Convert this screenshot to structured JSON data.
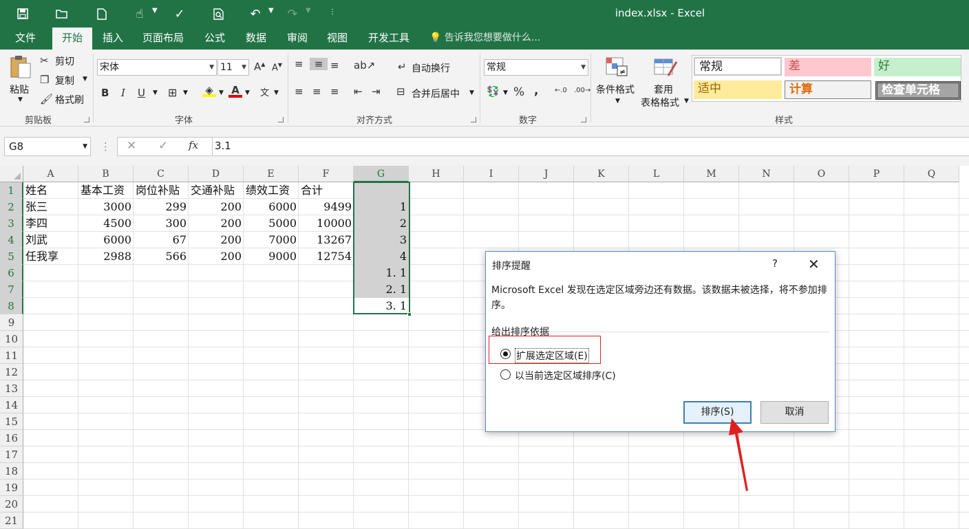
{
  "app": {
    "window_title": "index.xlsx - Excel"
  },
  "tabs": [
    "文件",
    "开始",
    "插入",
    "页面布局",
    "公式",
    "数据",
    "审阅",
    "视图",
    "开发工具"
  ],
  "tell_me": "告诉我您想要做什么...",
  "ribbon": {
    "clipboard": {
      "paste": "粘贴",
      "cut": "剪切",
      "copy": "复制",
      "format_painter": "格式刷",
      "label": "剪贴板"
    },
    "font": {
      "name": "宋体",
      "size": "11",
      "bold": "B",
      "italic": "I",
      "underline": "U",
      "label": "字体"
    },
    "alignment": {
      "wrap_text": "自动换行",
      "merge_center": "合并后居中",
      "label": "对齐方式"
    },
    "number": {
      "format": "常规",
      "percent": "%",
      "comma": ",",
      "label": "数字"
    },
    "styles": {
      "conditional": "条件格式",
      "table_format_1": "套用",
      "table_format_2": "表格格式",
      "label": "样式",
      "cells": [
        "常规",
        "差",
        "好",
        "适中",
        "计算",
        "检查单元格"
      ]
    }
  },
  "formula_bar": {
    "name_box": "G8",
    "fx": "fx",
    "value": "3.1"
  },
  "sheet": {
    "columns": [
      "A",
      "B",
      "C",
      "D",
      "E",
      "F",
      "G",
      "H",
      "I",
      "J",
      "K",
      "L",
      "M",
      "N",
      "O",
      "P",
      "Q"
    ],
    "selected_column": "G",
    "rows": [
      "1",
      "2",
      "3",
      "4",
      "5",
      "6",
      "7",
      "8",
      "9",
      "10",
      "11",
      "12",
      "13",
      "14",
      "15",
      "16",
      "17",
      "18",
      "19",
      "20",
      "21"
    ],
    "headers": [
      "姓名",
      "基本工资",
      "岗位补贴",
      "交通补贴",
      "绩效工资",
      "合计"
    ],
    "data": [
      [
        "张三",
        "3000",
        "299",
        "200",
        "6000",
        "9499",
        "1"
      ],
      [
        "李四",
        "4500",
        "300",
        "200",
        "5000",
        "10000",
        "2"
      ],
      [
        "刘武",
        "6000",
        "67",
        "200",
        "7000",
        "13267",
        "3"
      ],
      [
        "任我享",
        "2988",
        "566",
        "200",
        "9000",
        "12754",
        "4"
      ]
    ],
    "g_extra": [
      "1. 1",
      "2. 1",
      "3. 1"
    ]
  },
  "dialog": {
    "title": "排序提醒",
    "help": "?",
    "message": "Microsoft Excel 发现在选定区域旁边还有数据。该数据未被选择，将不参加排序。",
    "group_label": "给出排序依据",
    "option_expand": "扩展选定区域(E)",
    "option_current": "以当前选定区域排序(C)",
    "sort_button": "排序(S)",
    "cancel_button": "取消"
  },
  "colors": {
    "brand": "#217346",
    "annotation": "#e02020",
    "selection": "#d2d2d2"
  }
}
